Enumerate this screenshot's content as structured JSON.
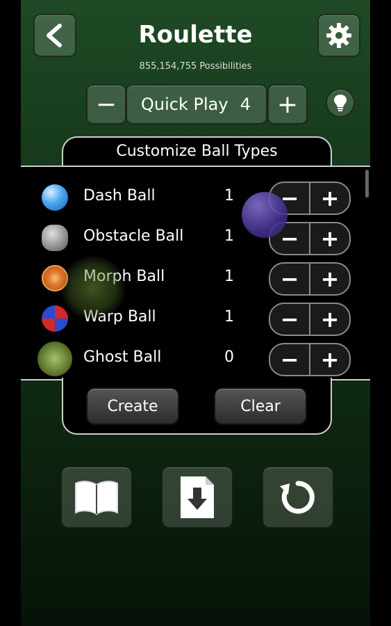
{
  "header": {
    "title": "Roulette",
    "subtitle": "855,154,755 Possibilities"
  },
  "quick_play": {
    "label": "Quick Play",
    "count": "4",
    "minus": "−",
    "plus": "+"
  },
  "customize": {
    "heading": "Customize Ball Types",
    "balls": [
      {
        "name": "Dash Ball",
        "count": "1",
        "icon": "dash-ball-icon"
      },
      {
        "name": "Obstacle Ball",
        "count": "1",
        "icon": "obstacle-ball-icon"
      },
      {
        "name": "Morph Ball",
        "count": "1",
        "icon": "morph-ball-icon"
      },
      {
        "name": "Warp Ball",
        "count": "1",
        "icon": "warp-ball-icon"
      },
      {
        "name": "Ghost Ball",
        "count": "0",
        "icon": "ghost-ball-icon"
      }
    ],
    "stepper_minus": "−",
    "stepper_plus": "+"
  },
  "actions": {
    "create": "Create",
    "clear": "Clear"
  },
  "bottom_icons": [
    "book-icon",
    "download-icon",
    "reset-icon"
  ],
  "colors": {
    "background_top": "#1f4a25",
    "background_bottom": "#061207",
    "dash_ball": "#4aa6f0",
    "obstacle_ball": "#9a9a9a",
    "morph_ball": "#e0772a",
    "warp_ball": "#d02a2a",
    "ghost_ball": "#6e8a3a"
  }
}
